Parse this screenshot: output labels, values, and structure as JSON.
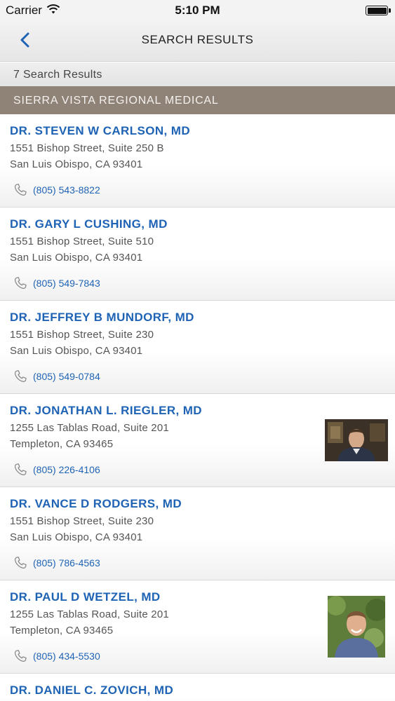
{
  "status_bar": {
    "carrier": "Carrier",
    "time": "5:10 PM"
  },
  "nav": {
    "title": "SEARCH RESULTS"
  },
  "results": {
    "count_label": "7 Search Results"
  },
  "section": {
    "title": "SIERRA VISTA REGIONAL MEDICAL"
  },
  "doctors": [
    {
      "name": "DR. STEVEN W CARLSON, MD",
      "address1": "1551 Bishop Street, Suite 250 B",
      "address2": "San Luis Obispo, CA 93401",
      "phone": "(805) 543-8822"
    },
    {
      "name": "DR. GARY L CUSHING, MD",
      "address1": "1551 Bishop Street, Suite 510",
      "address2": "San Luis Obispo, CA 93401",
      "phone": "(805) 549-7843"
    },
    {
      "name": "DR. JEFFREY B MUNDORF, MD",
      "address1": "1551 Bishop Street, Suite 230",
      "address2": "San Luis Obispo, CA 93401",
      "phone": "(805) 549-0784"
    },
    {
      "name": "DR. JONATHAN L. RIEGLER, MD",
      "address1": "1255 Las Tablas Road, Suite 201",
      "address2": "Templeton, CA 93465",
      "phone": "(805) 226-4106"
    },
    {
      "name": "DR. VANCE D RODGERS, MD",
      "address1": "1551 Bishop Street, Suite 230",
      "address2": "San Luis Obispo, CA 93401",
      "phone": "(805) 786-4563"
    },
    {
      "name": "DR. PAUL D WETZEL, MD",
      "address1": "1255 Las Tablas Road, Suite 201",
      "address2": "Templeton, CA 93465",
      "phone": "(805) 434-5530"
    },
    {
      "name": "DR. DANIEL C. ZOVICH, MD"
    }
  ],
  "icons": {
    "back": "chevron-left-icon",
    "phone": "phone-icon",
    "wifi": "wifi-icon",
    "battery": "battery-icon"
  },
  "colors": {
    "link": "#1f63b5",
    "section_header": "#8f8277"
  }
}
